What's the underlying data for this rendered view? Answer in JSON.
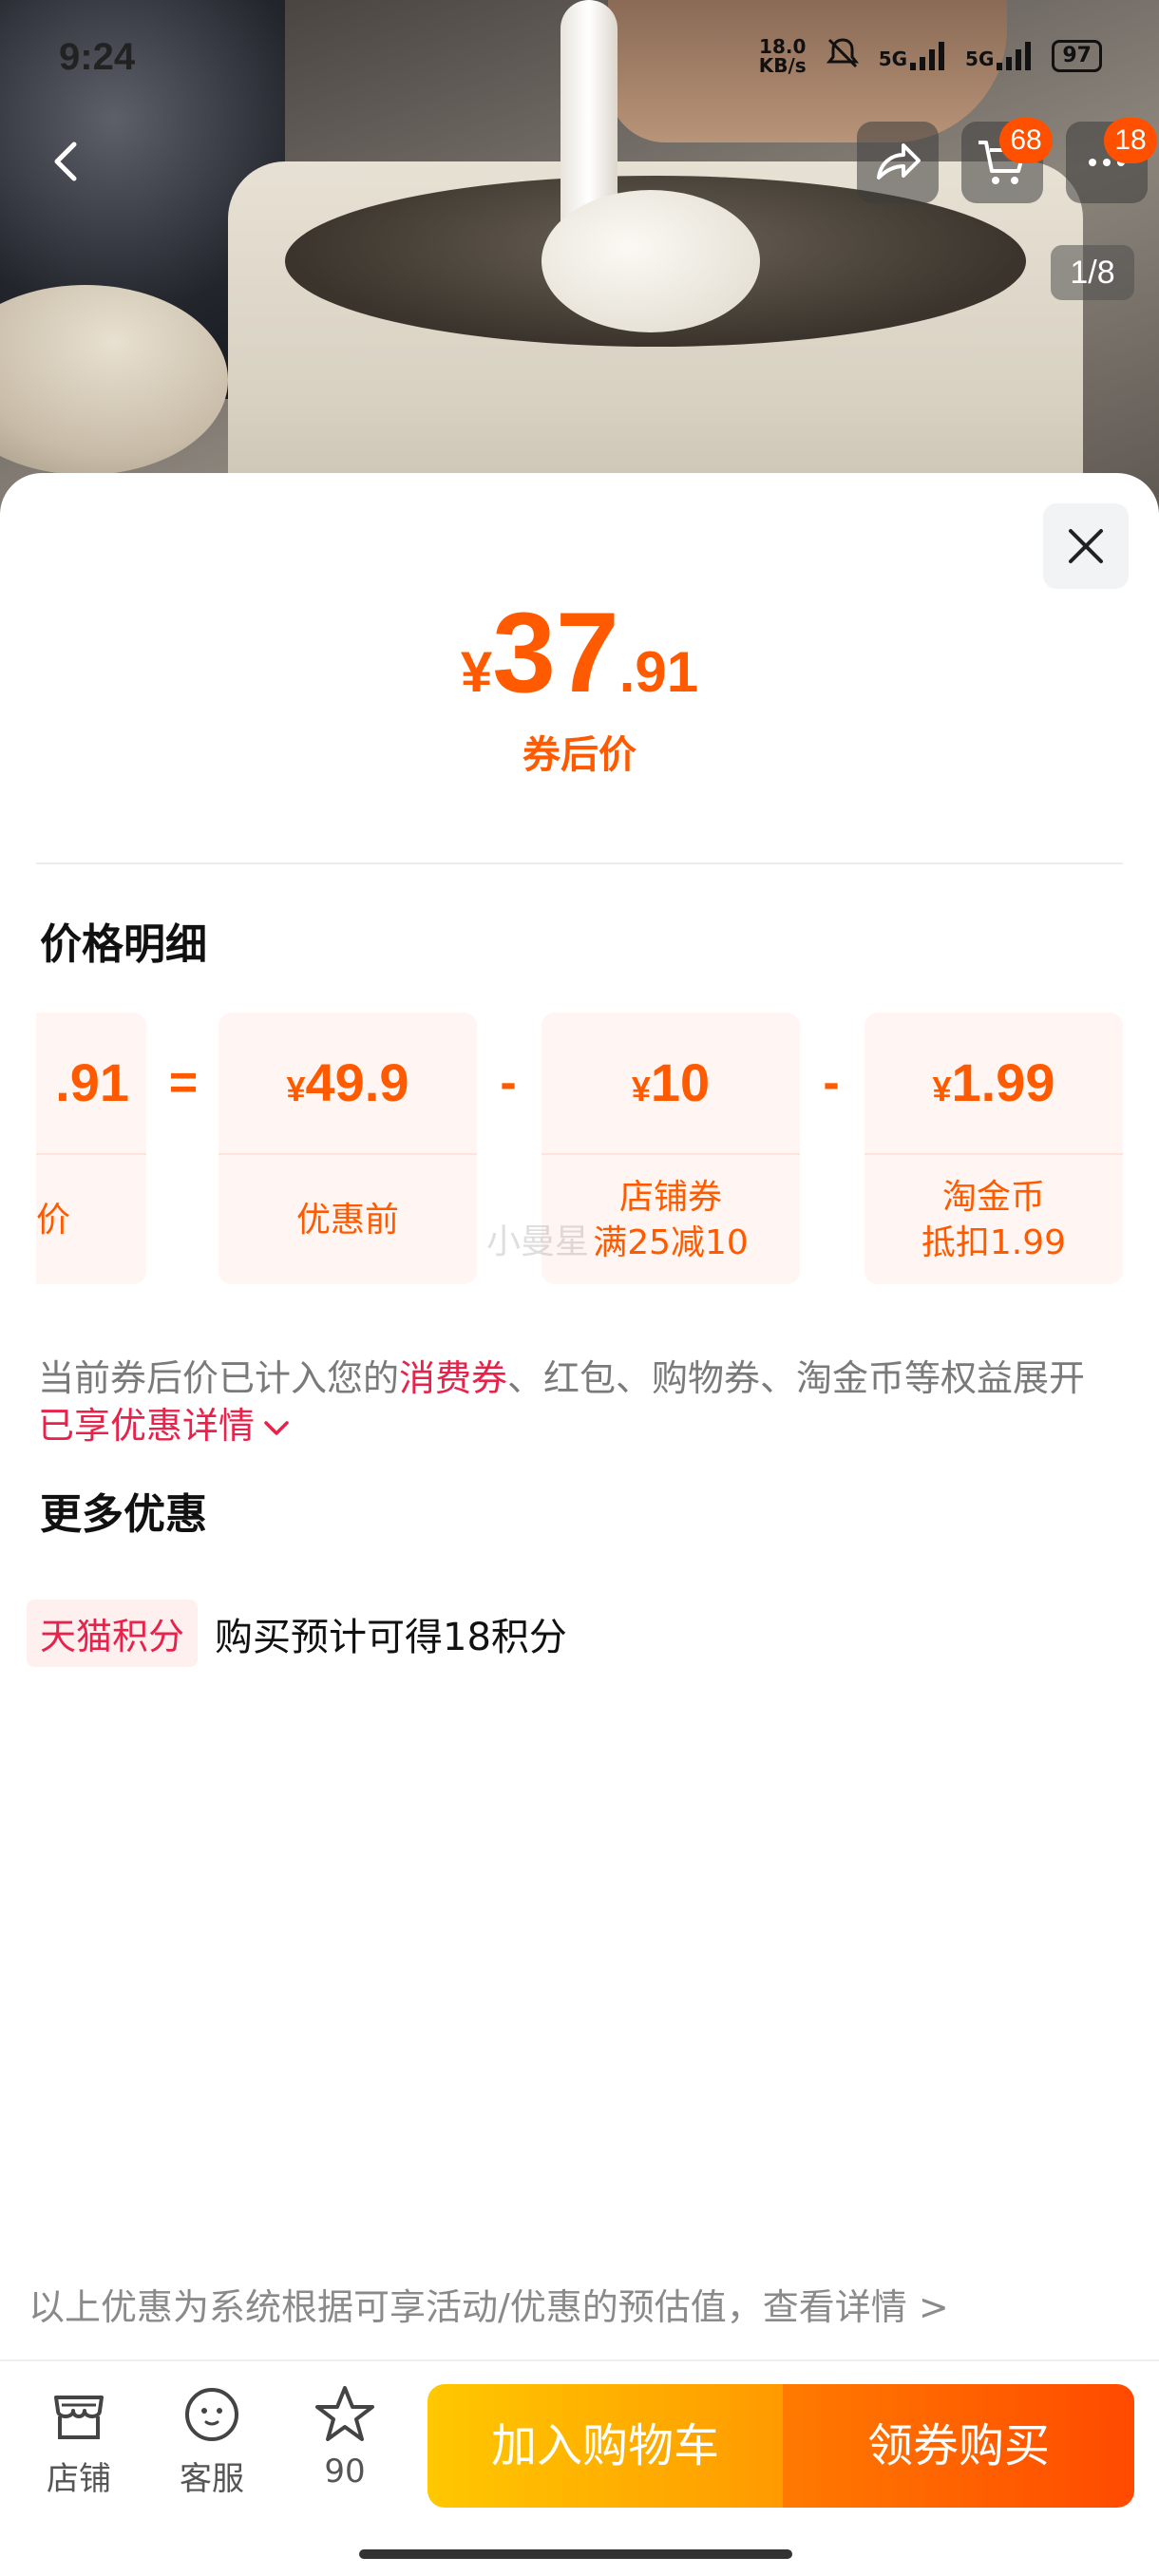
{
  "status_bar": {
    "time": "9:24",
    "net_speed_value": "18.0",
    "net_speed_unit": "KB/s",
    "signal1": "5G",
    "signal2": "5G",
    "battery": "97"
  },
  "header": {
    "cart_badge": "68",
    "more_badge": "18",
    "page_indicator": "1/8"
  },
  "price": {
    "currency": "¥",
    "integer": "37",
    "decimal": ".91",
    "label": "券后价"
  },
  "breakdown": {
    "title": "价格明细",
    "partial_amount": ".91",
    "partial_label": "价",
    "eq_symbol": "=",
    "minus_symbol": "-",
    "items": [
      {
        "yen": "¥",
        "amount": "49.9",
        "line1": "优惠前",
        "line2": ""
      },
      {
        "yen": "¥",
        "amount": "10",
        "line1": "店铺券",
        "line2": "满25减10"
      },
      {
        "yen": "¥",
        "amount": "1.99",
        "line1": "淘金币",
        "line2": "抵扣1.99"
      }
    ],
    "watermark": "小曼星"
  },
  "note": {
    "part1": "当前券后价已计入您的",
    "highlight1": "消费券",
    "part2": "、红包、购物券、淘金币等权益展开",
    "highlight2": "已享优惠详情"
  },
  "more": {
    "title": "更多优惠",
    "tag": "天猫积分",
    "text": "购买预计可得18积分"
  },
  "footer_note": "以上优惠为系统根据可享活动/优惠的预估值，查看详情 >",
  "bottom_bar": {
    "store_label": "店铺",
    "service_label": "客服",
    "favorite_count": "90",
    "add_cart_label": "加入购物车",
    "buy_label": "领券购买"
  },
  "colors": {
    "accent": "#ff5a00",
    "highlight": "#e8224a",
    "cart_button": "#ffb400",
    "buy_button": "#ff5a00"
  }
}
